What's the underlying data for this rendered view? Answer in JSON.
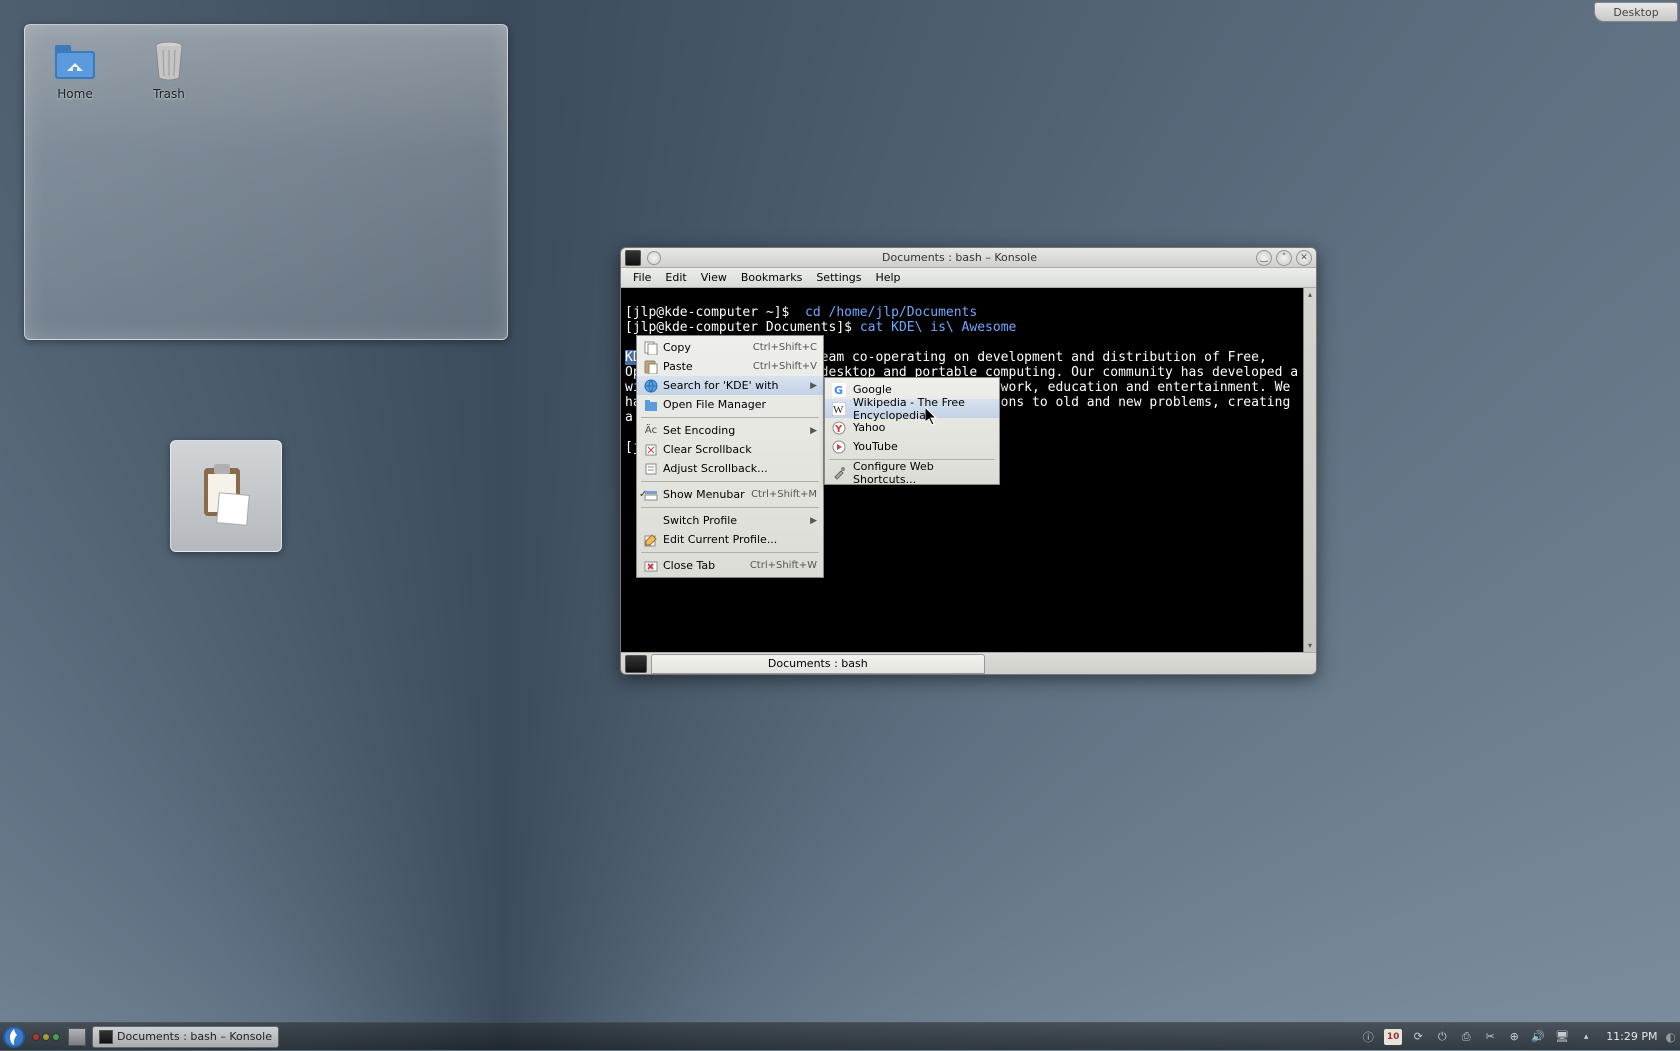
{
  "cashew": {
    "label": "Desktop"
  },
  "desktop_icons": {
    "home": "Home",
    "trash": "Trash"
  },
  "konsole": {
    "title": "Documents : bash – Konsole",
    "menus": [
      "File",
      "Edit",
      "View",
      "Bookmarks",
      "Settings",
      "Help"
    ],
    "tab_label": "Documents : bash",
    "terminal": {
      "line1_prompt": "[jlp@kde-computer ~]$ ",
      "line1_cmd": " cd /home/jlp/Documents",
      "line2_prompt": "[jlp@kde-computer Documents]$ ",
      "line2_cmd": "cat KDE\\ is\\ Awesome",
      "para": "KDE is an international team co-operating on development and distribution of Free, Open Source Software for desktop and portable computing. Our community has developed a wide variety of applications for communication, work, education and entertainment. We have a strong focus on finding innovative solutions to old and new problems, creating a vibrant, open atmosphere for experimentation.",
      "selected_word": "KDE",
      "line_last": "[jlp@kde-computer Documents]$ "
    }
  },
  "context_menu": {
    "copy": "Copy",
    "copy_sc": "Ctrl+Shift+C",
    "paste": "Paste",
    "paste_sc": "Ctrl+Shift+V",
    "search": "Search for 'KDE' with",
    "open_fm": "Open File Manager",
    "set_enc": "Set Encoding",
    "clear_sb": "Clear Scrollback",
    "adjust_sb": "Adjust Scrollback...",
    "show_mb": "Show Menubar",
    "show_mb_sc": "Ctrl+Shift+M",
    "switch_prof": "Switch Profile",
    "edit_prof": "Edit Current Profile...",
    "close_tab": "Close Tab",
    "close_tab_sc": "Ctrl+Shift+W"
  },
  "submenu": {
    "google": "Google",
    "wikipedia": "Wikipedia - The Free Encyclopedia",
    "yahoo": "Yahoo",
    "youtube": "YouTube",
    "configure": "Configure Web Shortcuts..."
  },
  "taskbar": {
    "task1": "Documents : bash – Konsole",
    "calendar_day": "10",
    "clock": "11:29 PM"
  }
}
